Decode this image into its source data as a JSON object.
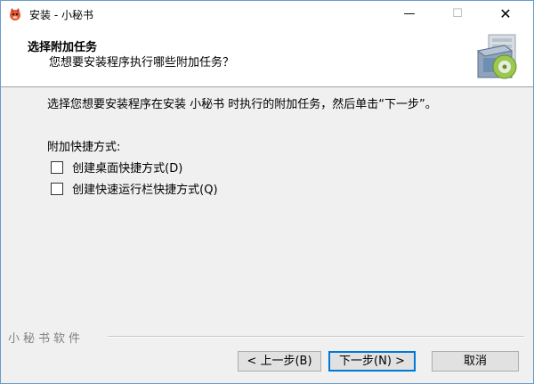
{
  "window": {
    "title": "安装 - 小秘书",
    "controls": {
      "minimize": "—",
      "maximize": "☐",
      "close": "✕"
    }
  },
  "header": {
    "title": "选择附加任务",
    "subtitle": "您想要安装程序执行哪些附加任务？"
  },
  "content": {
    "instruction": "选择您想要安装程序在安装 小秘书 时执行的附加任务，然后单击“下一步”。",
    "group_label": "附加快捷方式:",
    "tasks": [
      {
        "label": "创建桌面快捷方式(D)",
        "checked": false
      },
      {
        "label": "创建快速运行栏快捷方式(Q)",
        "checked": false
      }
    ]
  },
  "brand": "小秘书软件",
  "buttons": {
    "back": "< 上一步(B)",
    "next": "下一步(N) >",
    "cancel": "取消"
  },
  "icons": {
    "app": "red-cat-app-icon",
    "header": "installer-box-disc-icon"
  },
  "colors": {
    "window_border": "#6a9ccb",
    "default_button_border": "#0078d7",
    "body_bg": "#f0f0f0"
  }
}
